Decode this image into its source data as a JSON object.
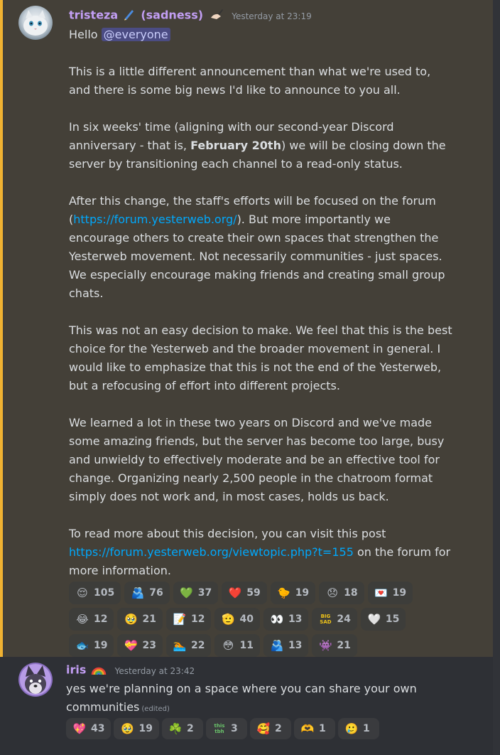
{
  "messages": [
    {
      "username": "tristeza",
      "username_suffix": "(sadness)",
      "timestamp": "Yesterday at 23:19",
      "greeting": "Hello",
      "mention": "@everyone",
      "paragraphs": {
        "p1": "This is a little different announcement than what we're used to, and there is some big news I'd like to announce to you all.",
        "p2a": "In six weeks' time (aligning with our second-year Discord anniversary - that is, ",
        "p2_bold": "February 20th",
        "p2b": ") we will be closing down the server by transitioning each channel to a read-only status.",
        "p3a": "After this change, the staff's efforts will be focused on the forum (",
        "p3_link": "https://forum.yesterweb.org/",
        "p3b": "). But more importantly we encourage others to create their own spaces that strengthen the Yesterweb movement. Not necessarily communities - just spaces. We especially encourage making friends and creating small group chats.",
        "p4": "This was not an easy decision to make. We feel that this is the best choice for the Yesterweb and the broader movement in general. I would like to emphasize that this is not the end of the Yesterweb, but a refocusing of effort into different projects.",
        "p5": "We learned a lot in these two years on Discord and we've made some amazing friends, but the server has become too large, busy and unwieldy to effectively moderate and be an effective tool for change. Organizing nearly 2,500 people in the chatroom format simply does not work and, in most cases, holds us back.",
        "p6a": "To read more about this decision, you can visit this post ",
        "p6_link": "https://forum.yesterweb.org/viewtopic.php?t=155",
        "p6b": " on the forum for more information."
      },
      "reactions": [
        {
          "icon": "relieved-face",
          "glyph": "😌",
          "count": "105"
        },
        {
          "icon": "hugging-people",
          "glyph": "🫂",
          "count": "76"
        },
        {
          "icon": "green-heart",
          "glyph": "💚",
          "count": "37"
        },
        {
          "icon": "red-heart",
          "glyph": "❤️",
          "count": "59"
        },
        {
          "icon": "custom-emoji",
          "glyph": "🐤",
          "count": "19"
        },
        {
          "icon": "custom-emoji",
          "glyph": "😞",
          "count": "18"
        },
        {
          "icon": "custom-emoji",
          "glyph": "💌",
          "count": "19"
        },
        {
          "icon": "joy-face",
          "glyph": "😂",
          "count": "12"
        },
        {
          "icon": "custom-emoji",
          "glyph": "🥹",
          "count": "21"
        },
        {
          "icon": "custom-emoji",
          "glyph": "📝",
          "count": "12"
        },
        {
          "icon": "custom-emoji",
          "glyph": "🫡",
          "count": "40"
        },
        {
          "icon": "eyes",
          "glyph": "👀",
          "count": "13"
        },
        {
          "icon": "big-sad",
          "glyph": "BIG SAD",
          "count": "24"
        },
        {
          "icon": "white-heart",
          "glyph": "🤍",
          "count": "15"
        },
        {
          "icon": "custom-emoji",
          "glyph": "🐟",
          "count": "19"
        },
        {
          "icon": "custom-emoji",
          "glyph": "💝",
          "count": "23"
        },
        {
          "icon": "custom-emoji",
          "glyph": "🏊",
          "count": "22"
        },
        {
          "icon": "custom-emoji",
          "glyph": "😳",
          "count": "11"
        },
        {
          "icon": "custom-emoji",
          "glyph": "🫂",
          "count": "13"
        },
        {
          "icon": "custom-emoji",
          "glyph": "👾",
          "count": "21"
        }
      ]
    },
    {
      "username": "iris",
      "timestamp": "Yesterday at 23:42",
      "text_a": "yes we're planning on a space where you can share your own communities",
      "edited": "(edited)",
      "reactions": [
        {
          "icon": "heart-sparkle",
          "glyph": "💖",
          "count": "43"
        },
        {
          "icon": "custom-emoji",
          "glyph": "🥹",
          "count": "19"
        },
        {
          "icon": "shamrock",
          "glyph": "☘️",
          "count": "2"
        },
        {
          "icon": "this-tbh",
          "glyph": "this tbh",
          "count": "3"
        },
        {
          "icon": "smiling-hearts-face",
          "glyph": "🥰",
          "count": "2"
        },
        {
          "icon": "custom-emoji",
          "glyph": "🫶",
          "count": "1"
        },
        {
          "icon": "custom-emoji",
          "glyph": "🥲",
          "count": "1"
        }
      ]
    }
  ],
  "colors": {
    "highlight_bg": "#444038",
    "highlight_border": "#f0b232",
    "link": "#00a8fc",
    "username": "#c29ef3"
  }
}
